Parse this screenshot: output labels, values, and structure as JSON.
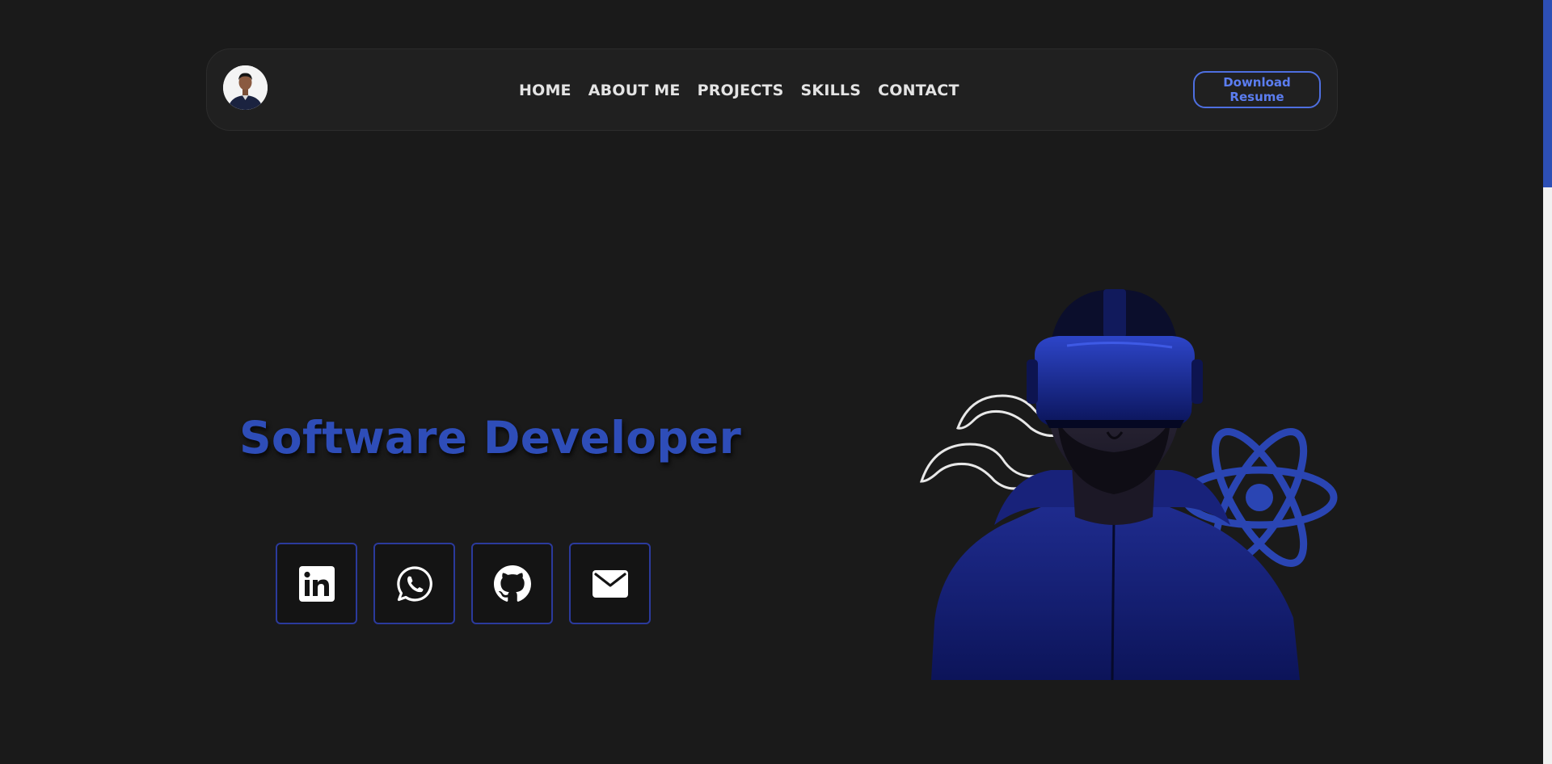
{
  "navbar": {
    "links": [
      "HOME",
      "ABOUT ME",
      "PROJECTS",
      "SKILLS",
      "CONTACT"
    ],
    "resume_label": "Download Resume"
  },
  "hero": {
    "title": "Software Developer"
  },
  "socials": [
    "linkedin-icon",
    "whatsapp-icon",
    "github-icon",
    "mail-icon"
  ],
  "colors": {
    "background": "#1a1a1a",
    "navbar": "#202020",
    "accent": "#2e4db8",
    "button_text": "#5b7df0",
    "social_border": "#2b3a9c"
  }
}
